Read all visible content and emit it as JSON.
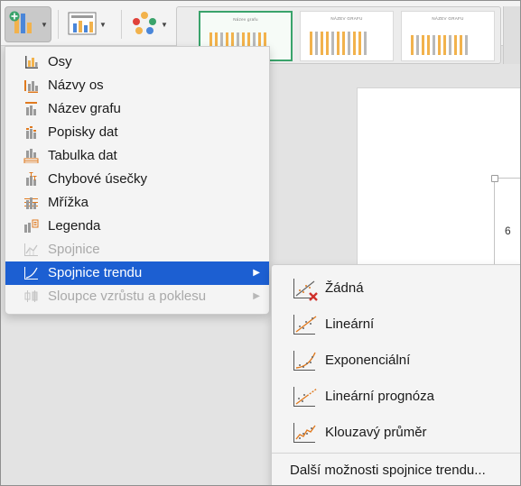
{
  "ribbon": {
    "add_element_icon": "add-chart-element-icon",
    "quick_layout_icon": "quick-layout-icon",
    "change_colors_icon": "change-colors-icon",
    "style_thumbs": [
      {
        "title": "Název grafu"
      },
      {
        "title": "NÁZEV GRAFU"
      },
      {
        "title": "NÁZEV GRAFU"
      }
    ]
  },
  "document": {
    "axis_tick": "6"
  },
  "menu": {
    "items": [
      {
        "label": "Osy",
        "icon": "axes-icon",
        "enabled": true
      },
      {
        "label": "Názvy os",
        "icon": "axis-titles-icon",
        "enabled": true
      },
      {
        "label": "Název grafu",
        "icon": "chart-title-icon",
        "enabled": true
      },
      {
        "label": "Popisky dat",
        "icon": "data-labels-icon",
        "enabled": true
      },
      {
        "label": "Tabulka dat",
        "icon": "data-table-icon",
        "enabled": true
      },
      {
        "label": "Chybové úsečky",
        "icon": "error-bars-icon",
        "enabled": true
      },
      {
        "label": "Mřížka",
        "icon": "gridlines-icon",
        "enabled": true
      },
      {
        "label": "Legenda",
        "icon": "legend-icon",
        "enabled": true
      },
      {
        "label": "Spojnice",
        "icon": "lines-icon",
        "enabled": false
      },
      {
        "label": "Spojnice trendu",
        "icon": "trendline-icon",
        "enabled": true,
        "highlighted": true,
        "submenu": true
      },
      {
        "label": "Sloupce vzrůstu a poklesu",
        "icon": "up-down-bars-icon",
        "enabled": false,
        "submenu": true
      }
    ]
  },
  "submenu": {
    "items": [
      {
        "label": "Žádná",
        "icon": "trendline-none-icon"
      },
      {
        "label": "Lineární",
        "icon": "trendline-linear-icon"
      },
      {
        "label": "Exponenciální",
        "icon": "trendline-exponential-icon"
      },
      {
        "label": "Lineární prognóza",
        "icon": "trendline-linear-forecast-icon"
      },
      {
        "label": "Klouzavý průměr",
        "icon": "trendline-moving-average-icon"
      }
    ],
    "more_options": "Další možnosti spojnice trendu..."
  },
  "colors": {
    "highlight": "#1c5fd2",
    "selected_style_border": "#3aa36b",
    "bar_orange": "#f2b24c",
    "trend_line": "#e07a1f",
    "remove_x": "#d0302b"
  }
}
